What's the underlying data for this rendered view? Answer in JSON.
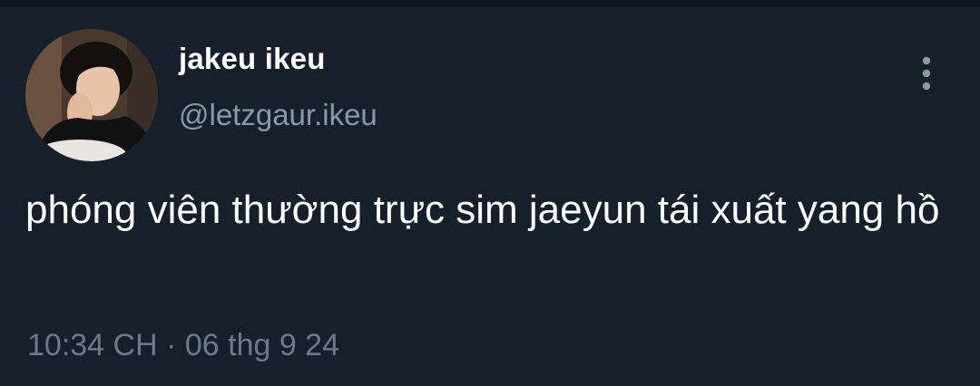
{
  "tweet": {
    "author": {
      "display_name": "jakeu ikeu",
      "handle": "@letzgaur.ikeu"
    },
    "text": "phóng viên thường trực sim jaeyun tái xuất yang hồ",
    "timestamp": "10:34 CH · 06 thg 9 24"
  },
  "icons": {
    "more": "more-vertical-icon"
  },
  "colors": {
    "background": "#15202b",
    "primary_text": "#ffffff",
    "secondary_text": "#8b98a5",
    "icon": "#8b98a5"
  }
}
